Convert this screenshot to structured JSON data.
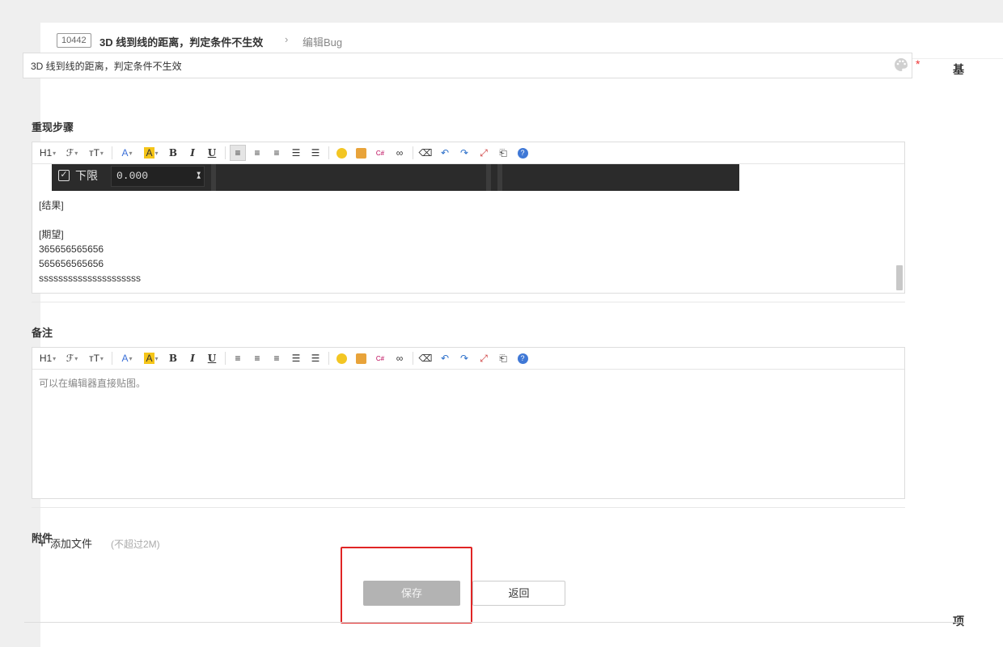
{
  "header": {
    "bug_id": "10442",
    "bug_title": "3D 线到线的距离，判定条件不生效",
    "separator": ">",
    "crumb_current": "编辑Bug"
  },
  "form": {
    "title_value": "3D 线到线的距离，判定条件不生效",
    "required_mark": "*",
    "side_label_1": "基",
    "side_label_2": "项"
  },
  "toolbar": {
    "heading": "H1",
    "font": "ℱ",
    "size": "ᴛT",
    "font_color": "A",
    "highlight": "A",
    "bold": "B",
    "italic": "I",
    "underline": "U",
    "icons": [
      "align-left-icon",
      "align-center-icon",
      "align-right-icon",
      "ordered-list-icon",
      "unordered-list-icon",
      "emoji-icon",
      "image-icon",
      "code-icon",
      "link-icon",
      "eraser-icon",
      "undo-icon",
      "redo-icon",
      "fullscreen-icon",
      "paste-icon",
      "help-icon"
    ]
  },
  "steps": {
    "label": "重现步骤",
    "embedded_checkbox_label": "下限",
    "embedded_value": "0.000",
    "lines": [
      "[结果]",
      "[期望]",
      "365656565656",
      "565656565656",
      "sssssssssssssssssssss"
    ]
  },
  "notes": {
    "label": "备注",
    "placeholder": "可以在编辑器直接贴图。"
  },
  "attachments": {
    "label": "附件",
    "add_file": "添加文件",
    "limit_hint": "(不超过2M)"
  },
  "actions": {
    "save": "保存",
    "back": "返回"
  },
  "colors": {
    "required": "#e33333",
    "highlight_box": "#e02525",
    "save_disabled_bg": "#b3b3b3"
  }
}
